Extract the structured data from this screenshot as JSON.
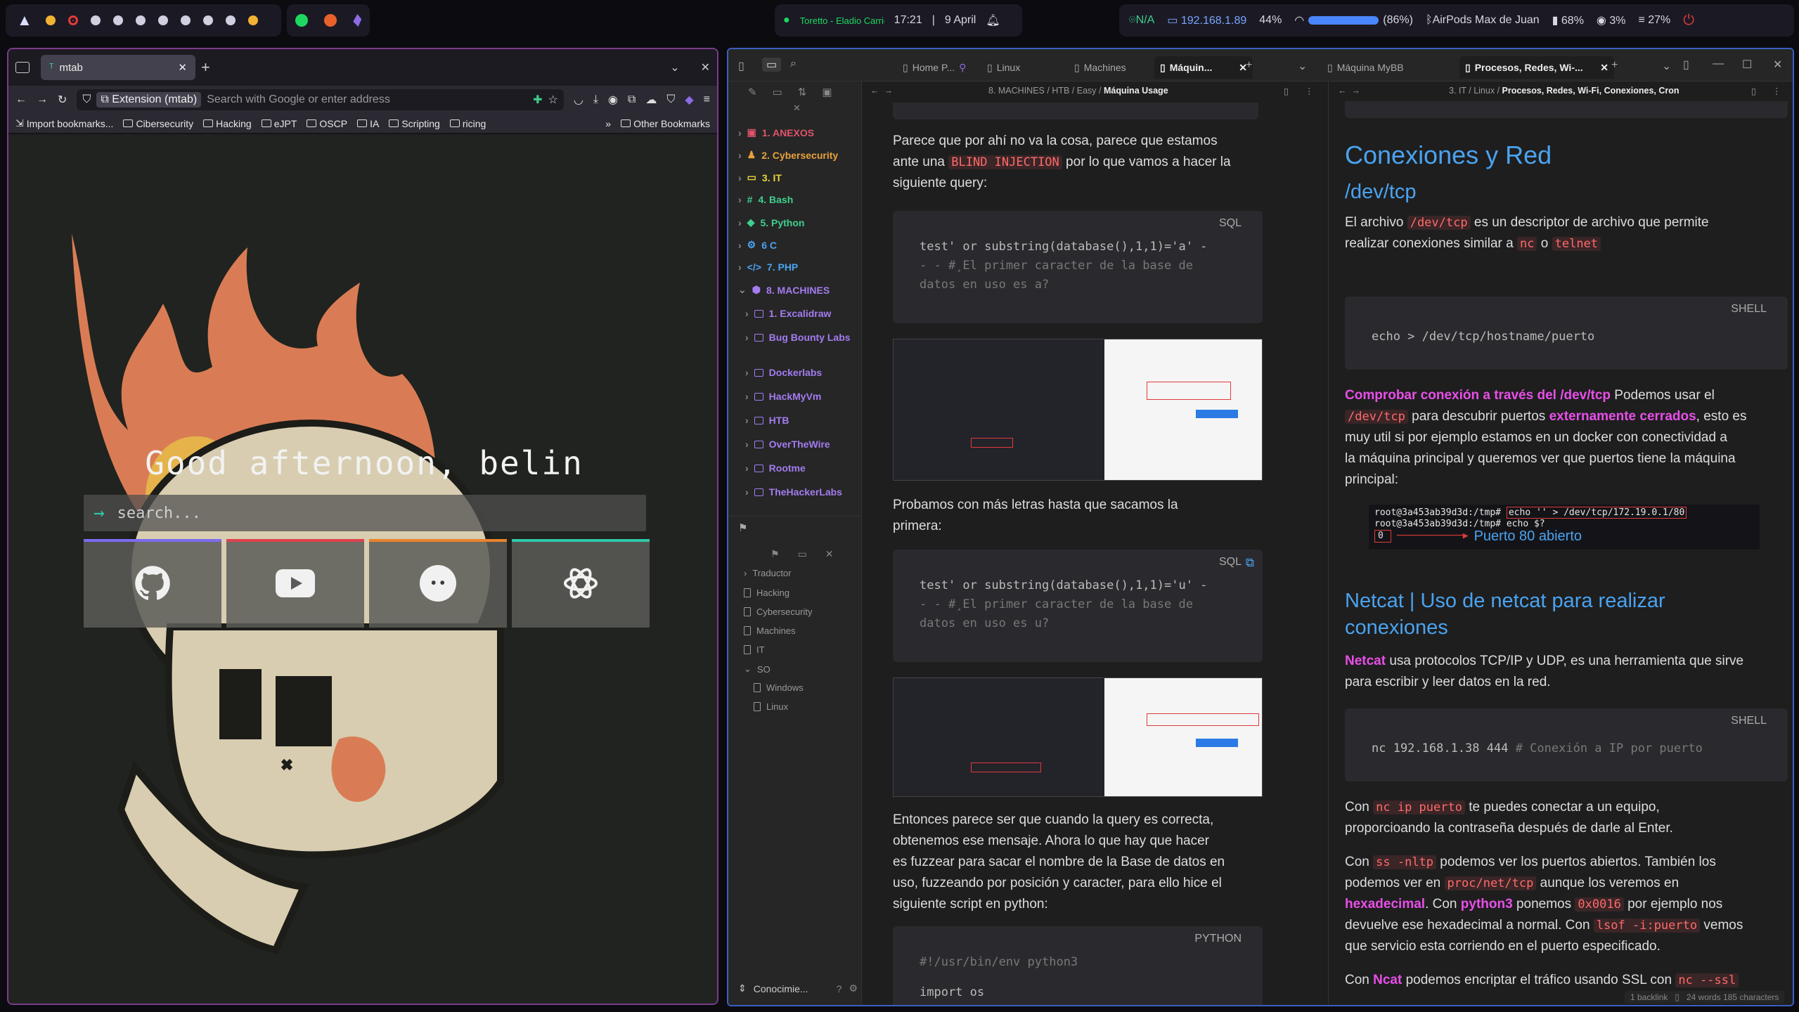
{
  "topbar": {
    "clock": "17:21",
    "date": "9 April",
    "now_playing": "Toretto - Eladio Carrion",
    "net_status": "N/A",
    "ip": "192.168.1.89",
    "brightness": "44%",
    "wifi": "(86%)",
    "bluetooth": "AirPods Max de Juan",
    "battery": "68%",
    "cpu": "3%",
    "mem": "27%"
  },
  "firefox": {
    "tab_title": "mtab",
    "url_chip": "Extension (mtab)",
    "url_placeholder": "Search with Google or enter address",
    "bookmarks": [
      "Import bookmarks...",
      "Cibersecurity",
      "Hacking",
      "eJPT",
      "OSCP",
      "IA",
      "Scripting",
      "ricing"
    ],
    "other_bookmarks": "Other Bookmarks",
    "greeting": "Good afternoon, belin",
    "search_placeholder": "search...",
    "tiles": [
      {
        "name": "github",
        "color": "#7b6cf0"
      },
      {
        "name": "youtube",
        "color": "#e0424e"
      },
      {
        "name": "reddit",
        "color": "#e9822c"
      },
      {
        "name": "openai",
        "color": "#2fc7a9"
      }
    ]
  },
  "obsidian": {
    "tabs": [
      "Home P...",
      "Linux",
      "Machines",
      "Máquin...",
      "Máquina MyBB",
      "Procesos, Redes, Wi-..."
    ],
    "tree": [
      {
        "label": "1. ANEXOS",
        "color": "#e0546a"
      },
      {
        "label": "2. Cybersecurity",
        "color": "#e9a23b"
      },
      {
        "label": "3. IT",
        "color": "#e7d63a"
      },
      {
        "label": "4. Bash",
        "color": "#3fcf8e"
      },
      {
        "label": "5. Python",
        "color": "#3fcf8e"
      },
      {
        "label": "6 C",
        "color": "#4aa3f0"
      },
      {
        "label": "7. PHP",
        "color": "#4aa3f0"
      },
      {
        "label": "8. MACHINES",
        "color": "#a37cf0"
      }
    ],
    "machines": [
      "1. Excalidraw",
      "Bug Bounty Labs",
      "Dockerlabs",
      "HackMyVm",
      "HTB",
      "OverTheWire",
      "Rootme",
      "TheHackerLabs"
    ],
    "bookmarks": [
      "Traductor",
      "Hacking",
      "Cybersecurity",
      "Machines",
      "IT",
      "SO",
      "Windows",
      "Linux"
    ],
    "vault": "Conocimie...",
    "left_pane": {
      "breadcrumb": [
        "8. MACHINES",
        "HTB",
        "Easy",
        "Máquina Usage"
      ],
      "p1a": "Parece que por ahí no va la cosa, parece que estamos",
      "p1b_pre": "ante una ",
      "p1b_code": "BLIND INJECTION",
      "p1b_post": " por lo que vamos a hacer la",
      "p1c": "siguiente query:",
      "code1_lang": "SQL",
      "code1_l1": "test' or substring(database(),1,1)='a' -",
      "code1_l2": "- - #¸El primer caracter de la base de",
      "code1_l3": "datos en uso es a?",
      "p2a": "Probamos con más letras hasta que sacamos la",
      "p2b": "primera:",
      "code2_lang": "SQL",
      "code2_l1": "test' or substring(database(),1,1)='u' -",
      "code2_l2": "- - #¸El primer caracter de la base de",
      "code2_l3": "datos en uso es u?",
      "p3": [
        "Entonces parece ser que cuando la query es correcta,",
        "obtenemos ese mensaje. Ahora lo que hay que hacer",
        "es fuzzear para sacar el nombre de la Base de datos en",
        "uso, fuzzeando por posición y caracter, para ello hice el",
        "siguiente script en python:"
      ],
      "code3_lang": "PYTHON",
      "code3_l1": "#!/usr/bin/env python3",
      "code3_l2": "import os"
    },
    "right_pane": {
      "breadcrumb": [
        "3. IT",
        "Linux",
        "Procesos, Redes, Wi-Fi, Conexiones, Cron"
      ],
      "h1": "Conexiones y Red",
      "h2a": "/dev/tcp",
      "p1a_pre": "El archivo ",
      "p1a_code": "/dev/tcp",
      "p1a_post": " es un descriptor de archivo que permite",
      "p1b_pre": "realizar conexiones similar a ",
      "p1b_code1": "nc",
      "p1b_mid": " o ",
      "p1b_code2": "telnet",
      "code1_lang": "SHELL",
      "code1": "echo > /dev/tcp/hostname/puerto",
      "p2_hl": "Comprobar conexión a través del /dev/tcp",
      "p2_a": " Podemos usar el",
      "p2_code": "/dev/tcp",
      "p2_b": " para descubrir puertos ",
      "p2_hl2": "externamente cerrados",
      ",p2_c": "",
      "p2_c2": ", esto es",
      "p2_l3": "muy util si por ejemplo estamos en un docker con conectividad a",
      "p2_l4": "la máquina principal y queremos ver que puertos tiene la máquina",
      "p2_l5": "principal:",
      "term_l1": "root@3a453ab39d3d:/tmp# ",
      "term_cmd": "echo '' > /dev/tcp/172.19.0.1/80",
      "term_l2": "root@3a453ab39d3d:/tmp# echo $?",
      "term_out": "0",
      "term_note": "Puerto 80 abierto",
      "h2b": "Netcat | Uso de netcat para realizar conexiones",
      "p3_hl": "Netcat",
      "p3_a": " usa protocolos TCP/IP y UDP, es una herramienta que sirve",
      "p3_b": "para escribir y leer datos en la red.",
      "code2_lang": "SHELL",
      "code2_cmd": "nc 192.168.1.38 444",
      "code2_cmt": " # Conexión a IP por puerto",
      "p4_a": "Con ",
      "p4_code": "nc ip puerto",
      "p4_b": " te puedes conectar a un equipo,",
      "p4_c": "proporcioando la contraseña después de darle al Enter.",
      "p5_a": "Con ",
      "p5_code": "ss -nltp",
      "p5_b": " podemos ver los puertos abiertos. También los",
      "p5_c": "podemos ver en ",
      "p5_code2": "proc/net/tcp",
      "p5_d": " aunque los veremos en",
      "p5_hl": "hexadecimal",
      "p5_e": ". Con ",
      "p5_hl2": "python3",
      "p5_f": " ponemos ",
      "p5_code3": "0x0016",
      "p5_g": " por ejemplo nos",
      "p5_h": "devuelve ese hexadecimal a normal. Con ",
      "p5_code4": "lsof -i:puerto",
      "p5_i": " vemos",
      "p5_j": "que servicio esta corriendo en el puerto especificado.",
      "p6_a": "Con ",
      "p6_hl": "Ncat",
      "p6_b": " podemos encriptar el tráfico usando SSL con ",
      "p6_code": "nc --ssl",
      "status": "1 backlink",
      "status2": "24 words 185 characters"
    }
  }
}
